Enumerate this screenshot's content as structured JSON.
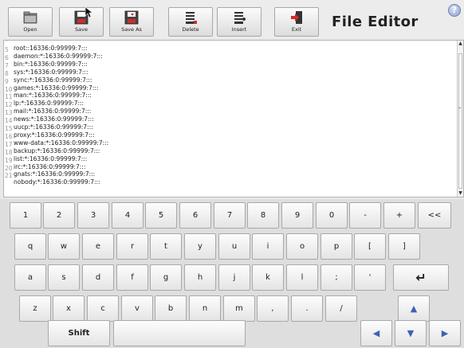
{
  "toolbar": {
    "buttons": [
      {
        "label": "Open",
        "icon": "folder-icon"
      },
      {
        "label": "Save",
        "icon": "save-icon"
      },
      {
        "label": "Save As",
        "icon": "save-as-icon"
      },
      {
        "label": "Delete",
        "icon": "delete-line-icon"
      },
      {
        "label": "Insert",
        "icon": "insert-line-icon"
      },
      {
        "label": "Exit",
        "icon": "exit-icon"
      }
    ],
    "title": "File Editor",
    "help_label": "?"
  },
  "editor": {
    "lines": [
      {
        "num": "5",
        "text": "root::16336:0:99999:7:::"
      },
      {
        "num": "6",
        "text": "daemon:*:16336:0:99999:7:::"
      },
      {
        "num": "7",
        "text": "bin:*:16336:0:99999:7:::"
      },
      {
        "num": "8",
        "text": "sys:*:16336:0:99999:7:::"
      },
      {
        "num": "9",
        "text": "sync:*:16336:0:99999:7:::"
      },
      {
        "num": "10",
        "text": "games:*:16336:0:99999:7:::"
      },
      {
        "num": "11",
        "text": "man:*:16336:0:99999:7:::"
      },
      {
        "num": "12",
        "text": "lp:*:16336:0:99999:7:::"
      },
      {
        "num": "13",
        "text": "mail:*:16336:0:99999:7:::"
      },
      {
        "num": "14",
        "text": "news:*:16336:0:99999:7:::"
      },
      {
        "num": "15",
        "text": "uucp:*:16336:0:99999:7:::"
      },
      {
        "num": "16",
        "text": "proxy:*:16336:0:99999:7:::"
      },
      {
        "num": "17",
        "text": "www-data:*:16336:0:99999:7:::"
      },
      {
        "num": "18",
        "text": "backup:*:16336:0:99999:7:::"
      },
      {
        "num": "19",
        "text": "list:*:16336:0:99999:7:::"
      },
      {
        "num": "20",
        "text": "irc:*:16336:0:99999:7:::"
      },
      {
        "num": "21",
        "text": "gnats:*:16336:0:99999:7:::"
      },
      {
        "num": "",
        "text": "nobody:*:16336:0:99999:7:::"
      }
    ]
  },
  "keyboard": {
    "row1": [
      "1",
      "2",
      "3",
      "4",
      "5",
      "6",
      "7",
      "8",
      "9",
      "0",
      "-",
      "+",
      "<<"
    ],
    "row2": [
      "q",
      "w",
      "e",
      "r",
      "t",
      "y",
      "u",
      "i",
      "o",
      "p",
      "[",
      "]"
    ],
    "row3": [
      "a",
      "s",
      "d",
      "f",
      "g",
      "h",
      "j",
      "k",
      "l",
      ";",
      "'",
      "↵"
    ],
    "row4": [
      "z",
      "x",
      "c",
      "v",
      "b",
      "n",
      "m",
      ",",
      ".",
      "/",
      "▲"
    ],
    "row5": [
      "Shift",
      "",
      "◀",
      "▼",
      "▶"
    ]
  },
  "colors": {
    "arrow_key": "#3b63b6",
    "accent_red": "#d42a2a"
  }
}
